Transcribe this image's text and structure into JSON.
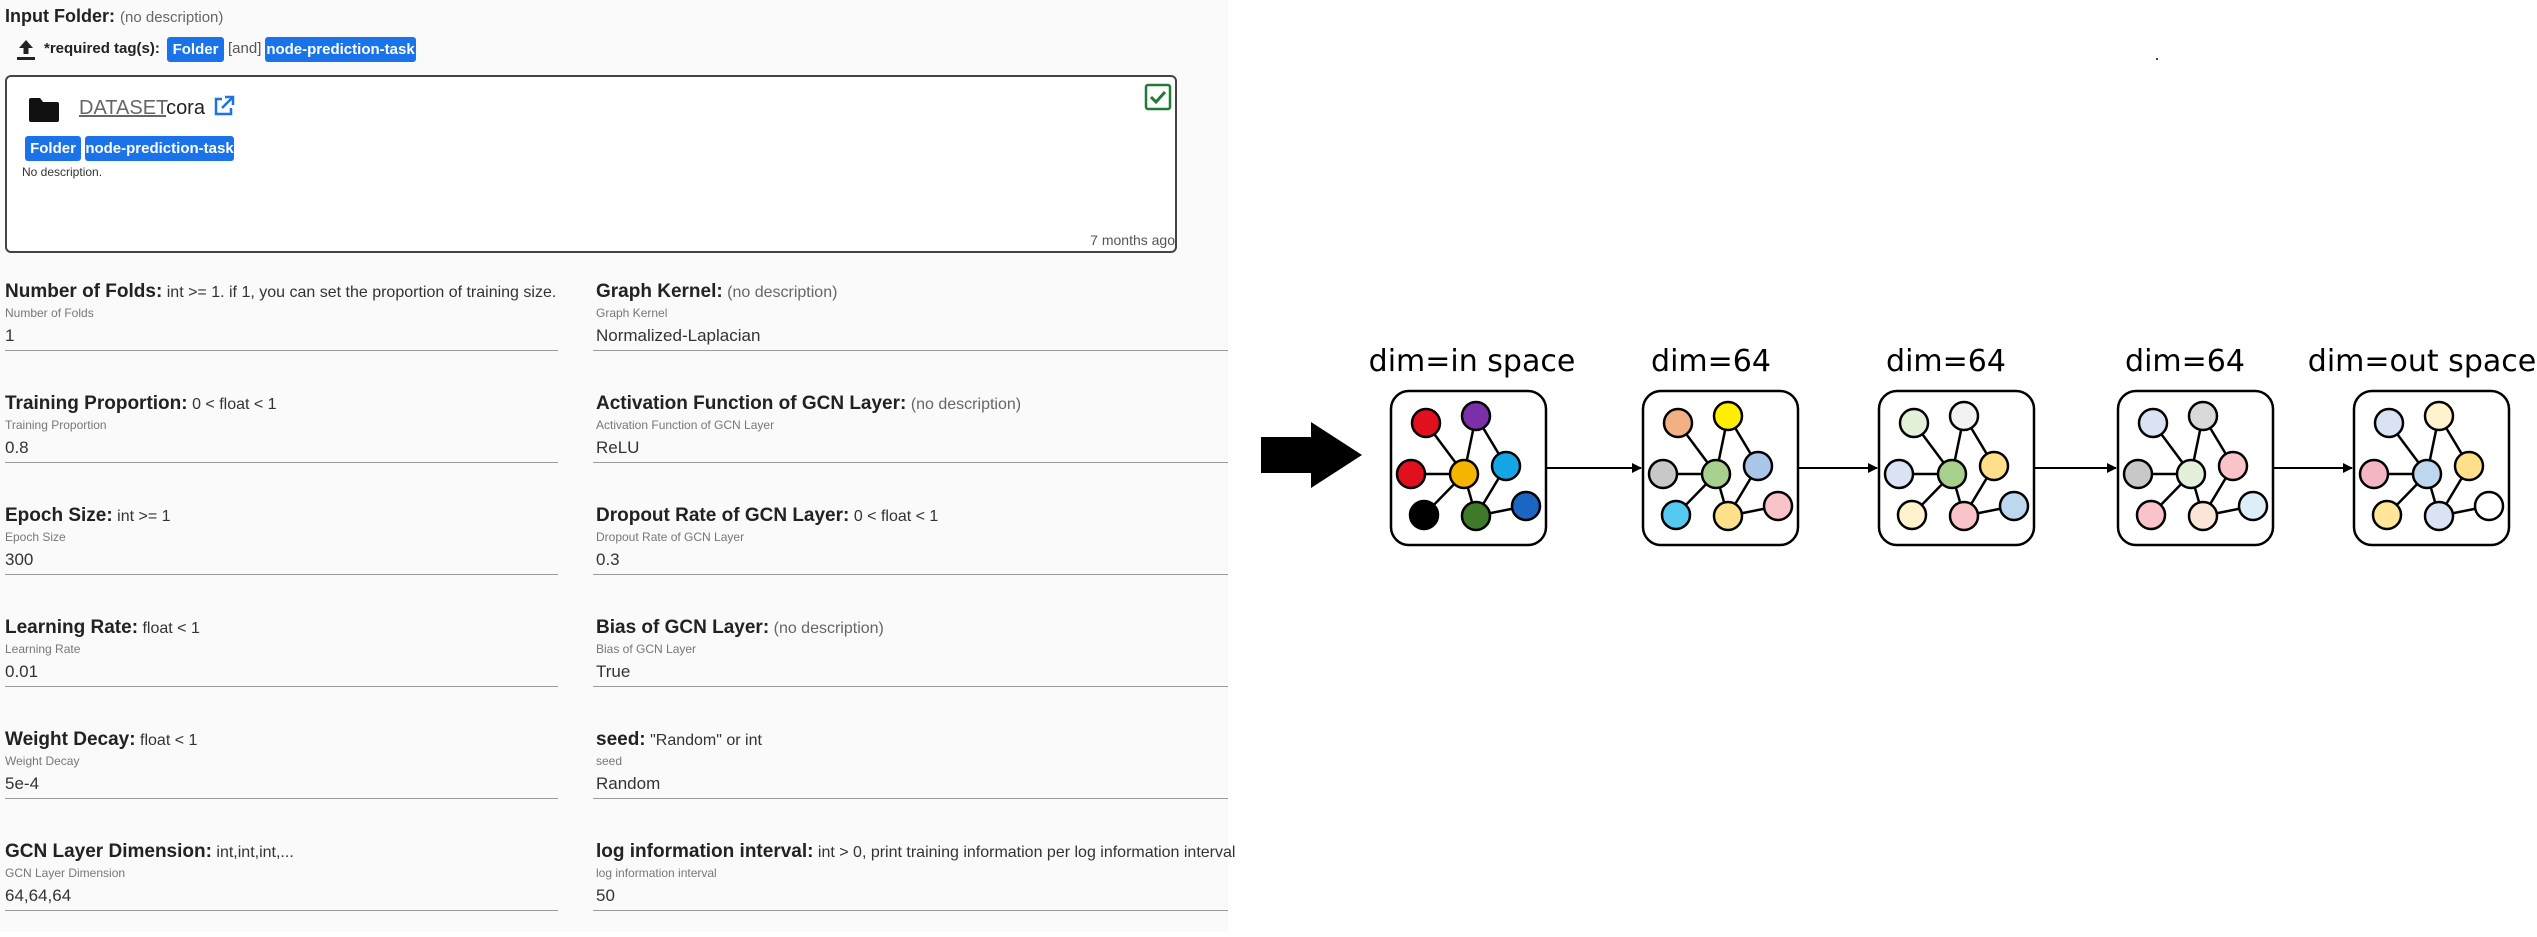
{
  "input_folder": {
    "label": "Input Folder:",
    "description": "(no description)",
    "required_tags_label": "*required tag(s):",
    "required_tags": [
      "Folder",
      "node-prediction-task"
    ],
    "joiner": "[and]"
  },
  "dataset_card": {
    "link_prefix": "DATASET",
    "name": "cora",
    "tags": [
      "Folder",
      "node-prediction-task"
    ],
    "description": "No description.",
    "time": "7 months ago",
    "checked": true
  },
  "fields_left": [
    {
      "label": "Number of Folds:",
      "desc": "int >= 1. if 1, you can set the proportion of training size.",
      "small": "Number of Folds",
      "value": "1"
    },
    {
      "label": "Training Proportion:",
      "desc": "0 < float < 1",
      "small": "Training Proportion",
      "value": "0.8"
    },
    {
      "label": "Epoch Size:",
      "desc": "int >= 1",
      "small": "Epoch Size",
      "value": "300"
    },
    {
      "label": "Learning Rate:",
      "desc": "float < 1",
      "small": "Learning Rate",
      "value": "0.01"
    },
    {
      "label": "Weight Decay:",
      "desc": "float < 1",
      "small": "Weight Decay",
      "value": "5e-4"
    },
    {
      "label": "GCN Layer Dimension:",
      "desc": "int,int,int,...",
      "small": "GCN Layer Dimension",
      "value": "64,64,64"
    }
  ],
  "fields_right": [
    {
      "label": "Graph Kernel:",
      "desc": "(no description)",
      "small": "Graph Kernel",
      "value": "Normalized-Laplacian"
    },
    {
      "label": "Activation Function of GCN Layer:",
      "desc": "(no description)",
      "small": "Activation Function of GCN Layer",
      "value": "ReLU"
    },
    {
      "label": "Dropout Rate of GCN Layer:",
      "desc": "0 < float < 1",
      "small": "Dropout Rate of GCN Layer",
      "value": "0.3"
    },
    {
      "label": "Bias of GCN Layer:",
      "desc": "(no description)",
      "small": "Bias of GCN Layer",
      "value": "True"
    },
    {
      "label": "seed:",
      "desc": "\"Random\" or int",
      "small": "seed",
      "value": "Random"
    },
    {
      "label": "log information interval:",
      "desc": "int > 0, print training information per log information interval",
      "small": "log information interval",
      "value": "50"
    }
  ],
  "diagram": {
    "layers": [
      {
        "label": "dim=in space",
        "colors": [
          "#e0101e",
          "#7b2fa8",
          "#e0101e",
          "#f5b400",
          "#15a6e6",
          "#000000",
          "#3e7a2a",
          "#1a66c2"
        ]
      },
      {
        "label": "dim=64",
        "colors": [
          "#f2b184",
          "#ffee00",
          "#c8c8c8",
          "#a8d08d",
          "#a9c5e8",
          "#55c8ef",
          "#ffe08a",
          "#f9c3ca"
        ]
      },
      {
        "label": "dim=64",
        "colors": [
          "#e2efd9",
          "#f2f2f2",
          "#dae3f3",
          "#a8d08d",
          "#ffe08a",
          "#fff2cc",
          "#f9c3ca",
          "#bdd7ee"
        ]
      },
      {
        "label": "dim=64",
        "colors": [
          "#dae3f3",
          "#d9d9d9",
          "#c8c8c8",
          "#e2efd9",
          "#f9c3ca",
          "#f9c3ca",
          "#fbe5d6",
          "#ddeef9"
        ]
      },
      {
        "label": "dim=out space",
        "colors": [
          "#dae3f3",
          "#fff2cc",
          "#f4b6c2",
          "#bdd7ee",
          "#ffe08a",
          "#ffe699",
          "#dae3f3",
          "#ffffff"
        ]
      }
    ]
  }
}
